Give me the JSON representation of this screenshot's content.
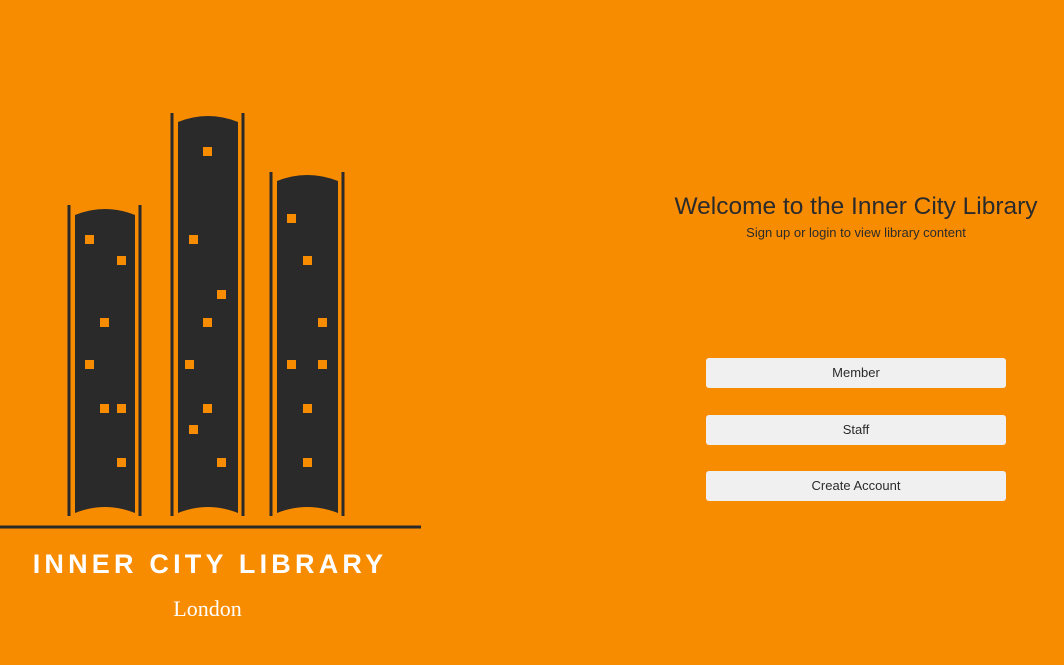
{
  "logo": {
    "name": "INNER CITY LIBRARY",
    "city": "London",
    "colors": {
      "book": "#2a2a2a",
      "window": "#f88c00",
      "text": "#ffffff"
    }
  },
  "welcome": {
    "title": "Welcome to the Inner City Library",
    "subtitle": "Sign up or login to view library content"
  },
  "buttons": {
    "member": "Member",
    "staff": "Staff",
    "create_account": "Create Account"
  },
  "colors": {
    "background": "#f88c00",
    "button_bg": "#f0f0f0",
    "text_dark": "#2b2b2b"
  }
}
